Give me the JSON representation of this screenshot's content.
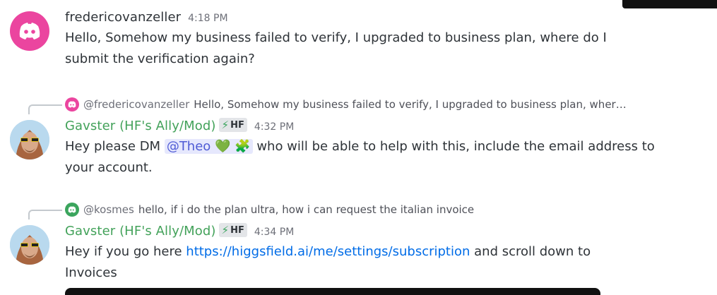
{
  "messages": [
    {
      "username": "fredericovanzeller",
      "time": "4:18 PM",
      "text": "Hello, Somehow my business failed to verify, I upgraded to business plan, where do I submit the verification again?",
      "avatar_icon": "discord-logo-icon"
    },
    {
      "reply": {
        "name": "@fredericovanzeller",
        "text": "Hello, Somehow my business failed to verify, I upgraded to business plan, wher…"
      },
      "username": "Gavster (HF's Ally/Mod)",
      "tag": "HF",
      "time": "4:32 PM",
      "text_before": "Hey please DM ",
      "mention": "@Theo",
      "mention_emoji": "💚 🧩",
      "text_after": " who will be able to help with this, include the email address to your account."
    },
    {
      "reply": {
        "name": "@kosmes",
        "text": "hello, if i do the plan ultra, how i can request the italian invoice"
      },
      "username": "Gavster (HF's Ally/Mod)",
      "tag": "HF",
      "time": "4:34 PM",
      "text_before": "Hey if you go here ",
      "link": "https://higgsfield.ai/me/settings/subscription",
      "text_after": " and scroll down to Invoices"
    }
  ],
  "colors": {
    "mod_name": "#43a25a",
    "link": "#006ce7",
    "mention_bg": "#e6e8fd",
    "discord_pink": "#eb459f"
  }
}
